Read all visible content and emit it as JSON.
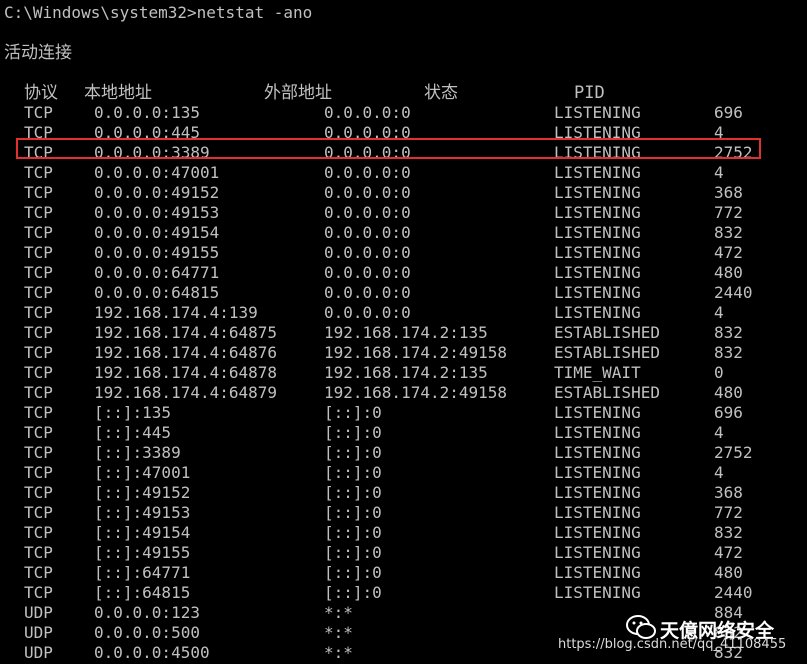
{
  "prompt": "C:\\Windows\\system32>netstat -ano",
  "section_title": "活动连接",
  "columns": {
    "proto": "协议",
    "local": "本地地址",
    "foreign": "外部地址",
    "state": "状态",
    "pid": "PID"
  },
  "rows": [
    {
      "proto": "TCP",
      "local": "0.0.0.0:135",
      "foreign": "0.0.0.0:0",
      "state": "LISTENING",
      "pid": "696"
    },
    {
      "proto": "TCP",
      "local": "0.0.0.0:445",
      "foreign": "0.0.0.0:0",
      "state": "LISTENING",
      "pid": "4"
    },
    {
      "proto": "TCP",
      "local": "0.0.0.0:3389",
      "foreign": "0.0.0.0:0",
      "state": "LISTENING",
      "pid": "2752"
    },
    {
      "proto": "TCP",
      "local": "0.0.0.0:47001",
      "foreign": "0.0.0.0:0",
      "state": "LISTENING",
      "pid": "4"
    },
    {
      "proto": "TCP",
      "local": "0.0.0.0:49152",
      "foreign": "0.0.0.0:0",
      "state": "LISTENING",
      "pid": "368"
    },
    {
      "proto": "TCP",
      "local": "0.0.0.0:49153",
      "foreign": "0.0.0.0:0",
      "state": "LISTENING",
      "pid": "772"
    },
    {
      "proto": "TCP",
      "local": "0.0.0.0:49154",
      "foreign": "0.0.0.0:0",
      "state": "LISTENING",
      "pid": "832"
    },
    {
      "proto": "TCP",
      "local": "0.0.0.0:49155",
      "foreign": "0.0.0.0:0",
      "state": "LISTENING",
      "pid": "472"
    },
    {
      "proto": "TCP",
      "local": "0.0.0.0:64771",
      "foreign": "0.0.0.0:0",
      "state": "LISTENING",
      "pid": "480"
    },
    {
      "proto": "TCP",
      "local": "0.0.0.0:64815",
      "foreign": "0.0.0.0:0",
      "state": "LISTENING",
      "pid": "2440"
    },
    {
      "proto": "TCP",
      "local": "192.168.174.4:139",
      "foreign": "0.0.0.0:0",
      "state": "LISTENING",
      "pid": "4"
    },
    {
      "proto": "TCP",
      "local": "192.168.174.4:64875",
      "foreign": "192.168.174.2:135",
      "state": "ESTABLISHED",
      "pid": "832"
    },
    {
      "proto": "TCP",
      "local": "192.168.174.4:64876",
      "foreign": "192.168.174.2:49158",
      "state": "ESTABLISHED",
      "pid": "832"
    },
    {
      "proto": "TCP",
      "local": "192.168.174.4:64878",
      "foreign": "192.168.174.2:135",
      "state": "TIME_WAIT",
      "pid": "0"
    },
    {
      "proto": "TCP",
      "local": "192.168.174.4:64879",
      "foreign": "192.168.174.2:49158",
      "state": "ESTABLISHED",
      "pid": "480"
    },
    {
      "proto": "TCP",
      "local": "[::]:135",
      "foreign": "[::]:0",
      "state": "LISTENING",
      "pid": "696"
    },
    {
      "proto": "TCP",
      "local": "[::]:445",
      "foreign": "[::]:0",
      "state": "LISTENING",
      "pid": "4"
    },
    {
      "proto": "TCP",
      "local": "[::]:3389",
      "foreign": "[::]:0",
      "state": "LISTENING",
      "pid": "2752"
    },
    {
      "proto": "TCP",
      "local": "[::]:47001",
      "foreign": "[::]:0",
      "state": "LISTENING",
      "pid": "4"
    },
    {
      "proto": "TCP",
      "local": "[::]:49152",
      "foreign": "[::]:0",
      "state": "LISTENING",
      "pid": "368"
    },
    {
      "proto": "TCP",
      "local": "[::]:49153",
      "foreign": "[::]:0",
      "state": "LISTENING",
      "pid": "772"
    },
    {
      "proto": "TCP",
      "local": "[::]:49154",
      "foreign": "[::]:0",
      "state": "LISTENING",
      "pid": "832"
    },
    {
      "proto": "TCP",
      "local": "[::]:49155",
      "foreign": "[::]:0",
      "state": "LISTENING",
      "pid": "472"
    },
    {
      "proto": "TCP",
      "local": "[::]:64771",
      "foreign": "[::]:0",
      "state": "LISTENING",
      "pid": "480"
    },
    {
      "proto": "TCP",
      "local": "[::]:64815",
      "foreign": "[::]:0",
      "state": "LISTENING",
      "pid": "2440"
    },
    {
      "proto": "UDP",
      "local": "0.0.0.0:123",
      "foreign": "*:*",
      "state": "",
      "pid": "884"
    },
    {
      "proto": "UDP",
      "local": "0.0.0.0:500",
      "foreign": "*:*",
      "state": "",
      "pid": "832"
    },
    {
      "proto": "UDP",
      "local": "0.0.0.0:4500",
      "foreign": "*:*",
      "state": "",
      "pid": "832"
    }
  ],
  "highlight_color": "#e03030",
  "watermark": {
    "title": "天億网络安全",
    "url": "https://blog.csdn.net/qq_41108455",
    "icon": "wechat-icon"
  }
}
